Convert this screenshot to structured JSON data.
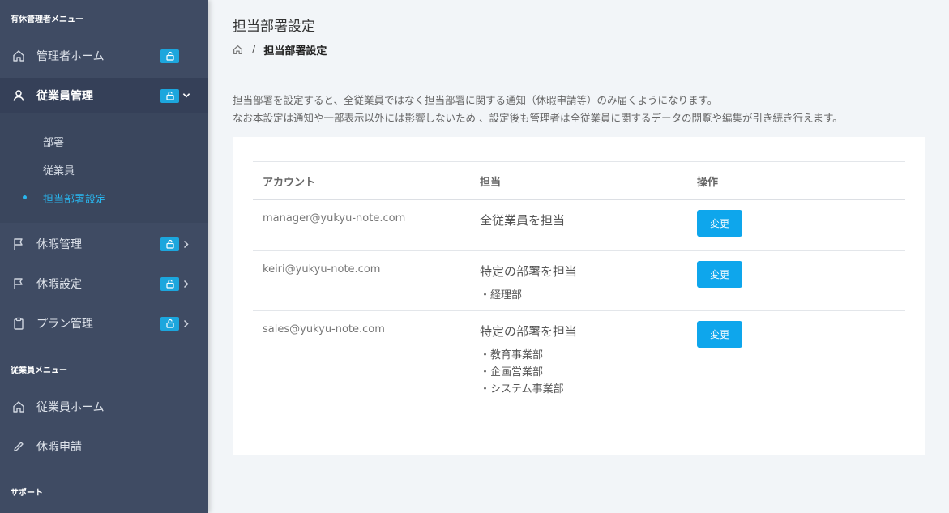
{
  "sidebar": {
    "admin_menu_title": "有休管理者メニュー",
    "employee_menu_title": "従業員メニュー",
    "support_title": "サポート",
    "items": {
      "admin_home": "管理者ホーム",
      "employee_management": "従業員管理",
      "leave_management": "休暇管理",
      "leave_settings": "休暇設定",
      "plan_management": "プラン管理",
      "employee_home": "従業員ホーム",
      "leave_request": "休暇申請"
    },
    "submenu": {
      "department": "部署",
      "employee": "従業員",
      "assigned_department": "担当部署設定"
    }
  },
  "page": {
    "title": "担当部署設定",
    "breadcrumb_sep": "/",
    "breadcrumb_current": "担当部署設定",
    "description_line1": "担当部署を設定すると、全従業員ではなく担当部署に関する通知（休暇申請等）のみ届くようになります。",
    "description_line2": "なお本設定は通知や一部表示以外には影響しないため 、設定後も管理者は全従業員に関するデータの閲覧や編集が引き続き行えます。"
  },
  "table": {
    "headers": {
      "account": "アカウント",
      "charge": "担当",
      "operation": "操作"
    },
    "rows": [
      {
        "account": "manager@yukyu-note.com",
        "charge": "全従業員を担当",
        "departments": [],
        "button": "変更"
      },
      {
        "account": "keiri@yukyu-note.com",
        "charge": "特定の部署を担当",
        "departments": [
          "・経理部"
        ],
        "button": "変更"
      },
      {
        "account": "sales@yukyu-note.com",
        "charge": "特定の部署を担当",
        "departments": [
          "・教育事業部",
          "・企画営業部",
          "・システム事業部"
        ],
        "button": "変更"
      }
    ]
  },
  "colors": {
    "sidebar_bg": "#3f4b63",
    "accent": "#1ca6dd",
    "button": "#0ea6ec",
    "active_sub": "#29b6ee"
  }
}
